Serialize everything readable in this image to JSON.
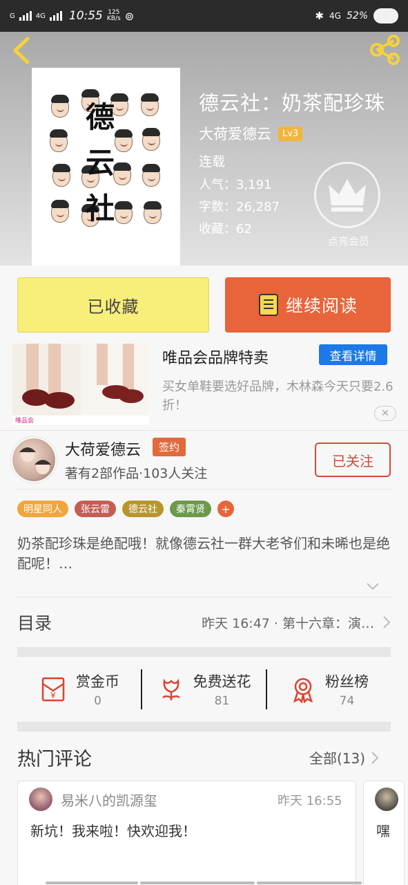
{
  "status_bar": {
    "network1": "G",
    "network2": "4G",
    "time": "10:55",
    "speed_value": "125",
    "speed_unit": "KB/s",
    "network3": "4G",
    "battery": "52%"
  },
  "book": {
    "title": "德云社：奶茶配珍珠",
    "author": "大荷爱德云",
    "author_level": "Lv3",
    "status": "连载",
    "popularity": "人气：3,191",
    "word_count": "字数：26,287",
    "favorites": "收藏：62",
    "member_label": "点亮会员"
  },
  "actions": {
    "collected_label": "已收藏",
    "continue_label": "继续阅读"
  },
  "ad": {
    "title": "唯品会品牌特卖",
    "button": "查看详情",
    "description": "买女单鞋要选好品牌，木林森今天只要2.6折！",
    "close": "✕",
    "logo_text": "唯品会"
  },
  "author_block": {
    "name": "大荷爱德云",
    "signed_badge": "签约",
    "stats": "著有2部作品·103人关注",
    "follow_label": "已关注"
  },
  "tags": [
    {
      "label": "明星同人",
      "color": "#f0a63f"
    },
    {
      "label": "张云雷",
      "color": "#c45d54"
    },
    {
      "label": "德云社",
      "color": "#b8962e"
    },
    {
      "label": "秦霄贤",
      "color": "#6a9a4a"
    },
    {
      "label": "+",
      "color": "#e8643a"
    }
  ],
  "synopsis": "奶茶配珍珠是绝配哦！就像德云社一群大老爷们和未晞也是绝配呢！…",
  "catalog": {
    "label": "目录",
    "latest": "昨天 16:47 · 第十六章：演…"
  },
  "rewards": [
    {
      "label": "赏金币",
      "count": "0",
      "icon": "coin-envelope-icon"
    },
    {
      "label": "免费送花",
      "count": "81",
      "icon": "flower-icon"
    },
    {
      "label": "粉丝榜",
      "count": "74",
      "icon": "medal-icon"
    }
  ],
  "comments_section": {
    "title": "热门评论",
    "all_label": "全部(13)",
    "items": [
      {
        "user": "易米八的凯源玺",
        "time": "昨天 16:55",
        "text": "新坑！我来啦！快欢迎我！"
      },
      {
        "user": "",
        "time": "",
        "text": "嘿"
      }
    ]
  },
  "colors": {
    "accent_orange": "#e8643a",
    "collected_yellow": "#f8ee7a",
    "ad_blue": "#1c79e6",
    "follow_red": "#d24a3d"
  }
}
